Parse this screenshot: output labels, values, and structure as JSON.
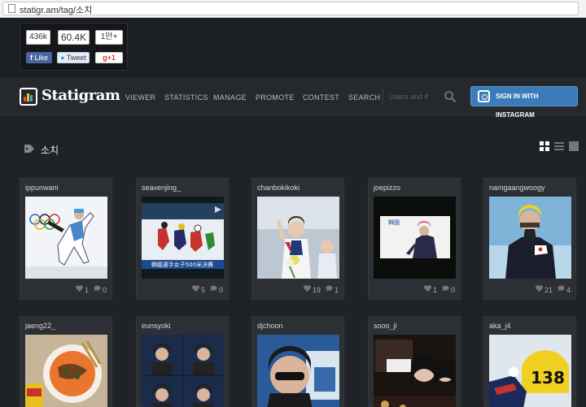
{
  "browser": {
    "url": "statigr.am/tag/소치"
  },
  "social": {
    "fb_count": "436k",
    "tw_count": "60.4K",
    "gp_count": "1만+",
    "fb_label": "Like",
    "tw_label": "Tweet",
    "gp_label": "+1"
  },
  "nav": {
    "logo": "Statigram",
    "items": [
      "VIEWER",
      "STATISTICS",
      "MANAGE",
      "PROMOTE",
      "CONTEST",
      "SEARCH"
    ],
    "search_placeholder": "Users and #",
    "sign_in": "SIGN IN WITH INSTAGRAM"
  },
  "tag": {
    "title": "소치"
  },
  "photos": [
    {
      "user": "ippunwani",
      "likes": "1",
      "comments": "0"
    },
    {
      "user": "seavenjing_",
      "likes": "5",
      "comments": "0"
    },
    {
      "user": "chanbokikoki",
      "likes": "19",
      "comments": "1"
    },
    {
      "user": "joepizzo",
      "likes": "1",
      "comments": "0"
    },
    {
      "user": "namgaangwoogy",
      "likes": "21",
      "comments": "4"
    },
    {
      "user": "jaeng22_"
    },
    {
      "user": "eunsyoki"
    },
    {
      "user": "djchoon"
    },
    {
      "user": "sooo_ji"
    },
    {
      "user": "aka_j4"
    }
  ],
  "photo_text": {
    "caption2": "韓國選手女子500米決賽",
    "sign4": "韓國",
    "num10": "138"
  },
  "colors": {
    "accent": "#3b7cb8",
    "bg": "#1f2226",
    "card": "#2c3035"
  }
}
